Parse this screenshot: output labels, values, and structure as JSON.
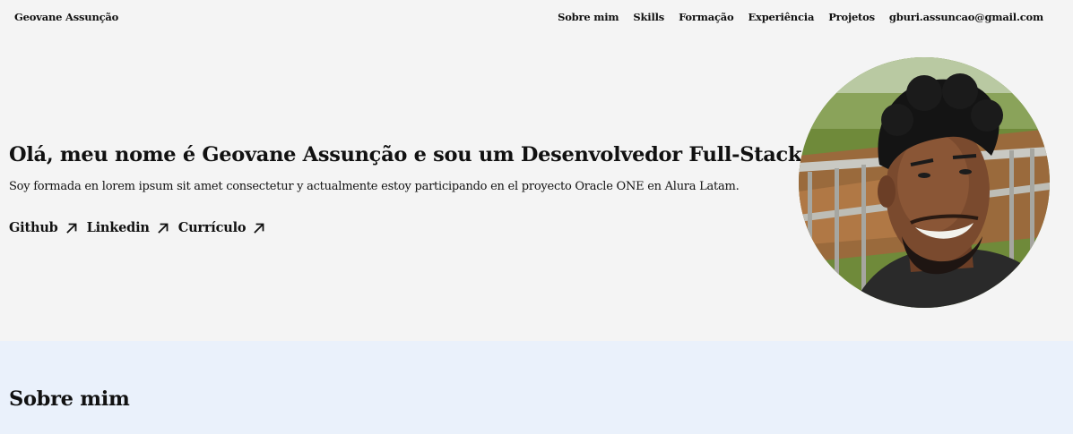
{
  "header": {
    "brand": "Geovane Assunção",
    "nav": [
      {
        "label": "Sobre mim"
      },
      {
        "label": "Skills"
      },
      {
        "label": "Formação"
      },
      {
        "label": "Experiência"
      },
      {
        "label": "Projetos"
      },
      {
        "label": "gburi.assuncao@gmail.com"
      }
    ]
  },
  "hero": {
    "title": "Olá, meu nome é Geovane Assunção e sou um Desenvolvedor Full-Stack",
    "subtitle": "Soy formada en lorem ipsum sit amet consectetur y actualmente estoy participando en el proyecto Oracle ONE en Alura Latam.",
    "links": [
      {
        "label": "Github",
        "icon": "arrow-up-right-icon"
      },
      {
        "label": "Linkedin",
        "icon": "arrow-up-right-icon"
      },
      {
        "label": "Currículo",
        "icon": "arrow-up-right-icon"
      }
    ],
    "photo": {
      "icon": "profile-photo"
    }
  },
  "about": {
    "title": "Sobre mim"
  },
  "colors": {
    "page_bg": "#f4f4f4",
    "about_bg": "#eaf1fb",
    "text": "#111111"
  }
}
